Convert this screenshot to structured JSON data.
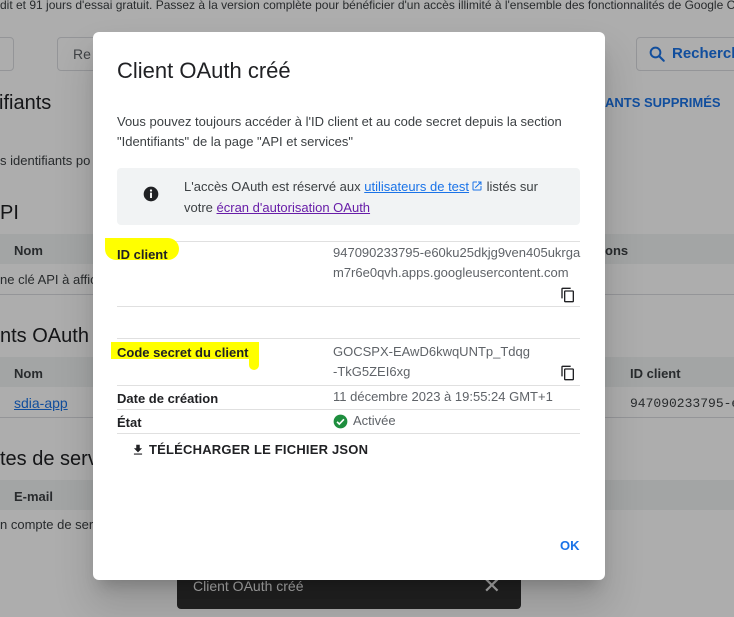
{
  "background": {
    "banner_text": "dit et 91 jours d'essai gratuit. Passez à la version complète pour bénéficier d'un accès illimité à l'ensemble des fonctionnalités de Google C",
    "filter_button_label": "Re",
    "search_button_label": "Recherch",
    "page_title": "ifiants",
    "deleted_link": "ANTS SUPPRIMÉS",
    "subtitle": "s identifiants po",
    "api_section": "PI",
    "api_col_name": "Nom",
    "api_col_actions": "ons",
    "api_row_text": "ne clé API à affich",
    "oauth_section": "nts OAuth 2",
    "oauth_col_name": "Nom",
    "oauth_col_client_id": "ID client",
    "oauth_row_name": "sdia-app",
    "oauth_row_client_id": "947090233795-e",
    "service_section": "tes de servic",
    "service_col_email": "E-mail",
    "service_row_text": "n compte de serv"
  },
  "snackbar": {
    "message": "Client OAuth créé",
    "close_symbol": "✕"
  },
  "dialog": {
    "title": "Client OAuth créé",
    "description": "Vous pouvez toujours accéder à l'ID client et au code secret depuis la section \"Identifiants\" de la page \"API et services\"",
    "info": {
      "text_before": "L'accès OAuth est réservé aux ",
      "link_test_users": "utilisateurs de test",
      "text_middle": " listés sur votre ",
      "link_consent_screen": "écran d'autorisation OAuth"
    },
    "fields": {
      "client_id_label": "ID client",
      "client_id_value": "947090233795-e60ku25dkjg9ven405ukrgam7r6e0qvh.apps.googleusercontent.com",
      "client_secret_label": "Code secret du client",
      "client_secret_value": "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",
      "created_label": "Date de création",
      "created_value": "11 décembre 2023 à 19:55:24 GMT+1",
      "state_label": "État",
      "state_value": "Activée"
    },
    "download_label": "TÉLÉCHARGER LE FICHIER JSON",
    "ok_label": "OK"
  },
  "icons": [
    "search-icon",
    "info-icon",
    "external-link-icon",
    "copy-icon",
    "check-circle-icon",
    "download-icon",
    "close-icon"
  ],
  "colors": {
    "accent": "#1a73e8",
    "visited_link": "#681da8",
    "success": "#1e8e3e",
    "highlight": "#ffff00"
  }
}
